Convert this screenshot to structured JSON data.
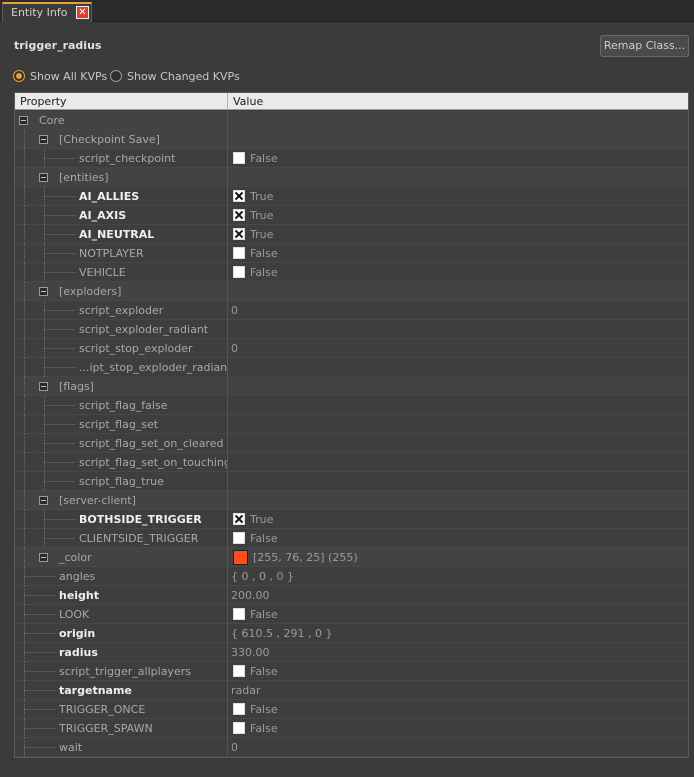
{
  "tab": {
    "label": "Entity Info",
    "close": "✕"
  },
  "entity": {
    "classname": "trigger_radius"
  },
  "remap_button": "Remap Class...",
  "filters": {
    "show_all": "Show All KVPs",
    "show_changed": "Show Changed KVPs",
    "selected": "show_all"
  },
  "grid": {
    "headers": {
      "property": "Property",
      "value": "Value"
    },
    "rows": [
      {
        "kind": "cat",
        "depth": 0,
        "label": "Core"
      },
      {
        "kind": "cat",
        "depth": 1,
        "label": "[Checkpoint Save]"
      },
      {
        "kind": "prop",
        "depth": 2,
        "label": "script_checkpoint",
        "type": "bool",
        "checked": false,
        "value": "False",
        "bold": false
      },
      {
        "kind": "cat",
        "depth": 1,
        "label": "[entities]"
      },
      {
        "kind": "prop",
        "depth": 2,
        "label": "AI_ALLIES",
        "type": "bool",
        "checked": true,
        "value": "True",
        "bold": true
      },
      {
        "kind": "prop",
        "depth": 2,
        "label": "AI_AXIS",
        "type": "bool",
        "checked": true,
        "value": "True",
        "bold": true
      },
      {
        "kind": "prop",
        "depth": 2,
        "label": "AI_NEUTRAL",
        "type": "bool",
        "checked": true,
        "value": "True",
        "bold": true
      },
      {
        "kind": "prop",
        "depth": 2,
        "label": "NOTPLAYER",
        "type": "bool",
        "checked": false,
        "value": "False",
        "bold": false
      },
      {
        "kind": "prop",
        "depth": 2,
        "label": "VEHICLE",
        "type": "bool",
        "checked": false,
        "value": "False",
        "bold": false
      },
      {
        "kind": "cat",
        "depth": 1,
        "label": "[exploders]"
      },
      {
        "kind": "prop",
        "depth": 2,
        "label": "script_exploder",
        "type": "text",
        "value": "0",
        "bold": false
      },
      {
        "kind": "prop",
        "depth": 2,
        "label": "script_exploder_radiant",
        "type": "text",
        "value": "",
        "bold": false
      },
      {
        "kind": "prop",
        "depth": 2,
        "label": "script_stop_exploder",
        "type": "text",
        "value": "0",
        "bold": false
      },
      {
        "kind": "prop",
        "depth": 2,
        "label": "...ipt_stop_exploder_radiant",
        "type": "text",
        "value": "",
        "bold": false
      },
      {
        "kind": "cat",
        "depth": 1,
        "label": "[flags]"
      },
      {
        "kind": "prop",
        "depth": 2,
        "label": "script_flag_false",
        "type": "text",
        "value": "",
        "bold": false
      },
      {
        "kind": "prop",
        "depth": 2,
        "label": "script_flag_set",
        "type": "text",
        "value": "",
        "bold": false
      },
      {
        "kind": "prop",
        "depth": 2,
        "label": "script_flag_set_on_cleared",
        "type": "text",
        "value": "",
        "bold": false
      },
      {
        "kind": "prop",
        "depth": 2,
        "label": "script_flag_set_on_touching",
        "type": "text",
        "value": "",
        "bold": false
      },
      {
        "kind": "prop",
        "depth": 2,
        "label": "script_flag_true",
        "type": "text",
        "value": "",
        "bold": false
      },
      {
        "kind": "cat",
        "depth": 1,
        "label": "[server-client]"
      },
      {
        "kind": "prop",
        "depth": 2,
        "label": "BOTHSIDE_TRIGGER",
        "type": "bool",
        "checked": true,
        "value": "True",
        "bold": true
      },
      {
        "kind": "prop",
        "depth": 2,
        "label": "CLIENTSIDE_TRIGGER",
        "type": "bool",
        "checked": false,
        "value": "False",
        "bold": false
      },
      {
        "kind": "cat",
        "depth": 1,
        "label": "_color",
        "type": "color",
        "color": "#ff4c19",
        "value": "[255, 76, 25] (255)"
      },
      {
        "kind": "prop",
        "depth": 1,
        "label": "angles",
        "type": "text",
        "value": "{ 0 , 0 , 0 }",
        "bold": false
      },
      {
        "kind": "prop",
        "depth": 1,
        "label": "height",
        "type": "text",
        "value": "200.00",
        "bold": true
      },
      {
        "kind": "prop",
        "depth": 1,
        "label": "LOOK",
        "type": "bool",
        "checked": false,
        "value": "False",
        "bold": false
      },
      {
        "kind": "prop",
        "depth": 1,
        "label": "origin",
        "type": "text",
        "value": "{ 610.5 , 291 , 0 }",
        "bold": true
      },
      {
        "kind": "prop",
        "depth": 1,
        "label": "radius",
        "type": "text",
        "value": "330.00",
        "bold": true
      },
      {
        "kind": "prop",
        "depth": 1,
        "label": "script_trigger_allplayers",
        "type": "bool",
        "checked": false,
        "value": "False",
        "bold": false
      },
      {
        "kind": "prop",
        "depth": 1,
        "label": "targetname",
        "type": "text",
        "value": "radar",
        "bold": true
      },
      {
        "kind": "prop",
        "depth": 1,
        "label": "TRIGGER_ONCE",
        "type": "bool",
        "checked": false,
        "value": "False",
        "bold": false
      },
      {
        "kind": "prop",
        "depth": 1,
        "label": "TRIGGER_SPAWN",
        "type": "bool",
        "checked": false,
        "value": "False",
        "bold": false
      },
      {
        "kind": "prop",
        "depth": 1,
        "label": "wait",
        "type": "text",
        "value": "0",
        "bold": false
      }
    ]
  },
  "colors": {
    "accent": "#e8a038",
    "background": "#3b3b3b",
    "header": "#eaeaea"
  }
}
